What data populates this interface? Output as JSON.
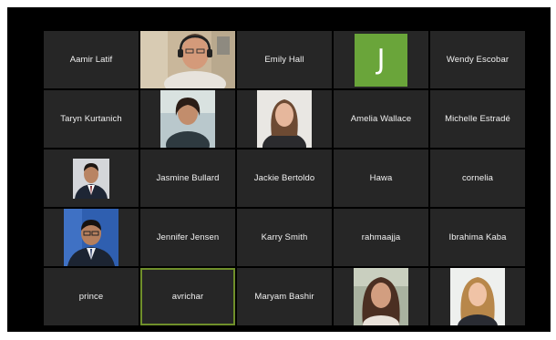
{
  "participants": [
    {
      "name": "Aamir Latif",
      "kind": "name"
    },
    {
      "name": "",
      "kind": "video",
      "icon": "webcam-man-headset"
    },
    {
      "name": "Emily Hall",
      "kind": "name"
    },
    {
      "name": "",
      "kind": "avatar",
      "initial": "J",
      "color": "#6aa53a"
    },
    {
      "name": "Wendy Escobar",
      "kind": "name"
    },
    {
      "name": "Taryn Kurtanich",
      "kind": "name"
    },
    {
      "name": "",
      "kind": "photo",
      "icon": "profile-woman-dark-hair"
    },
    {
      "name": "",
      "kind": "photo",
      "icon": "profile-woman-long-hair"
    },
    {
      "name": "Amelia Wallace",
      "kind": "name"
    },
    {
      "name": "Michelle Estradé",
      "kind": "name"
    },
    {
      "name": "",
      "kind": "photo",
      "icon": "profile-man-suit"
    },
    {
      "name": "Jasmine Bullard",
      "kind": "name"
    },
    {
      "name": "Jackie Bertoldo",
      "kind": "name"
    },
    {
      "name": "Hawa",
      "kind": "name"
    },
    {
      "name": "cornelia",
      "kind": "name"
    },
    {
      "name": "",
      "kind": "photo",
      "icon": "profile-man-blue-background"
    },
    {
      "name": "Jennifer Jensen",
      "kind": "name"
    },
    {
      "name": "Karry Smith",
      "kind": "name"
    },
    {
      "name": "rahmaajja",
      "kind": "name"
    },
    {
      "name": "Ibrahima Kaba",
      "kind": "name"
    },
    {
      "name": "prince",
      "kind": "name"
    },
    {
      "name": "avrichar",
      "kind": "name",
      "active": true
    },
    {
      "name": "Maryam Bashir",
      "kind": "name"
    },
    {
      "name": "",
      "kind": "photo",
      "icon": "profile-woman-curly-hair"
    },
    {
      "name": "",
      "kind": "photo",
      "icon": "profile-woman-blonde"
    }
  ],
  "colors": {
    "background": "#000000",
    "tile": "#262626",
    "active_speaker_border": "#6f8f2a",
    "avatar_green": "#6aa53a"
  }
}
